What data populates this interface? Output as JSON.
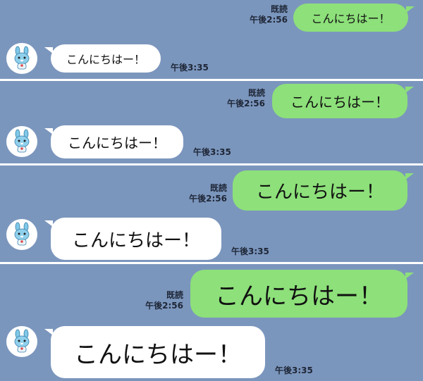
{
  "colors": {
    "chat_background": "#7b96bd",
    "sent_bubble": "#8de07a",
    "received_bubble": "#ffffff",
    "separator": "#ffffff"
  },
  "avatar_icon": "bunny-mascot-icon",
  "conversations": [
    {
      "sent": {
        "text": "こんにちはー！",
        "read_label": "既読",
        "time": "午後2:56"
      },
      "received": {
        "text": "こんにちはー！",
        "time": "午後3:35"
      }
    },
    {
      "sent": {
        "text": "こんにちはー！",
        "read_label": "既読",
        "time": "午後2:56"
      },
      "received": {
        "text": "こんにちはー！",
        "time": "午後3:35"
      }
    },
    {
      "sent": {
        "text": "こんにちはー！",
        "read_label": "既読",
        "time": "午後2:56"
      },
      "received": {
        "text": "こんにちはー！",
        "time": "午後3:35"
      }
    },
    {
      "sent": {
        "text": "こんにちはー！",
        "read_label": "既読",
        "time": "午後2:56"
      },
      "received": {
        "text": "こんにちはー！",
        "time": "午後3:35"
      }
    }
  ]
}
